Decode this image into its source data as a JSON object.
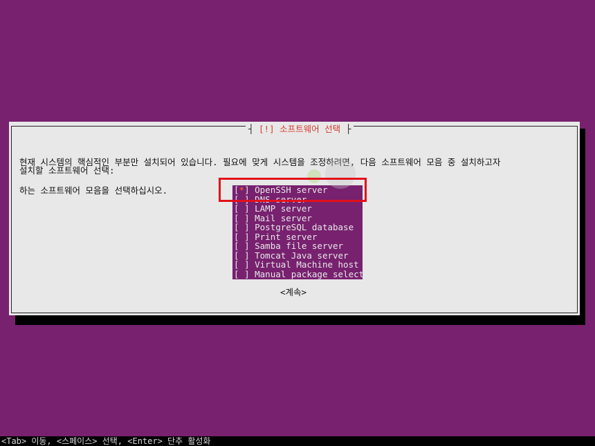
{
  "dialog": {
    "title_open": "┤",
    "title": " [!] 소프트웨어 선택 ",
    "title_close": "├",
    "description_lines": [
      "현재 시스템의 핵심적인 부분만 설치되어 있습니다. 필요에 맞게 시스템을 조정하려면, 다음 소프트웨어 모음 중 설치하고자",
      "하는 소프트웨어 모음을 선택하십시오."
    ],
    "prompt": "설치할 소프트웨어 선택:",
    "items": [
      {
        "box_open": "[",
        "check": "*",
        "box_close": "]",
        "label": " OpenSSH server",
        "checked": true
      },
      {
        "box_open": "[",
        "check": " ",
        "box_close": "]",
        "label": " DNS server",
        "checked": false
      },
      {
        "box_open": "[",
        "check": " ",
        "box_close": "]",
        "label": " LAMP server",
        "checked": false
      },
      {
        "box_open": "[",
        "check": " ",
        "box_close": "]",
        "label": " Mail server",
        "checked": false
      },
      {
        "box_open": "[",
        "check": " ",
        "box_close": "]",
        "label": " PostgreSQL database",
        "checked": false
      },
      {
        "box_open": "[",
        "check": " ",
        "box_close": "]",
        "label": " Print server",
        "checked": false
      },
      {
        "box_open": "[",
        "check": " ",
        "box_close": "]",
        "label": " Samba file server",
        "checked": false
      },
      {
        "box_open": "[",
        "check": " ",
        "box_close": "]",
        "label": " Tomcat Java server",
        "checked": false
      },
      {
        "box_open": "[",
        "check": " ",
        "box_close": "]",
        "label": " Virtual Machine host",
        "checked": false
      },
      {
        "box_open": "[",
        "check": " ",
        "box_close": "]",
        "label": " Manual package selection",
        "checked": false
      }
    ],
    "continue_label": "<계속>"
  },
  "status_bar": "<Tab> 이동, <스페이스> 선택, <Enter> 단추 활성화",
  "colors": {
    "background": "#77216f",
    "dialog": "#e8e8e8",
    "title": "#d33a2c",
    "highlight": "#e3101a",
    "checked_mark": "#ff6a2b"
  }
}
